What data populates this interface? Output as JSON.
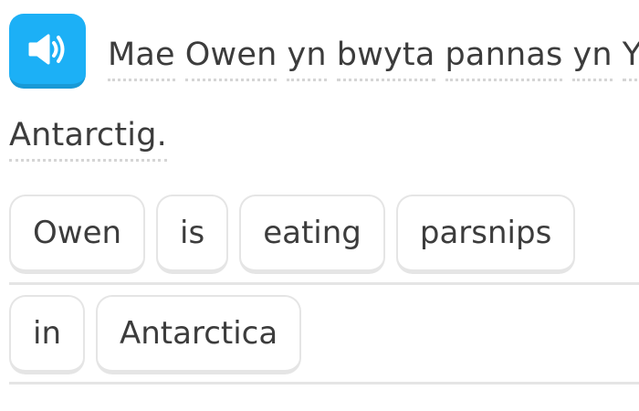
{
  "exercise": {
    "speaker_icon": "speaker-icon",
    "prompt_line1": [
      "Mae",
      "Owen",
      "yn",
      "bwyta",
      "pannas",
      "yn",
      "Yr"
    ],
    "prompt_line2": [
      "Antarctig."
    ],
    "answer_row1": [
      "Owen",
      "is",
      "eating",
      "parsnips"
    ],
    "answer_row2": [
      "in",
      "Antarctica"
    ]
  },
  "colors": {
    "speaker_button": "#1cb0f6",
    "tile_border": "#e5e5e5",
    "text": "#3c3c3c"
  }
}
